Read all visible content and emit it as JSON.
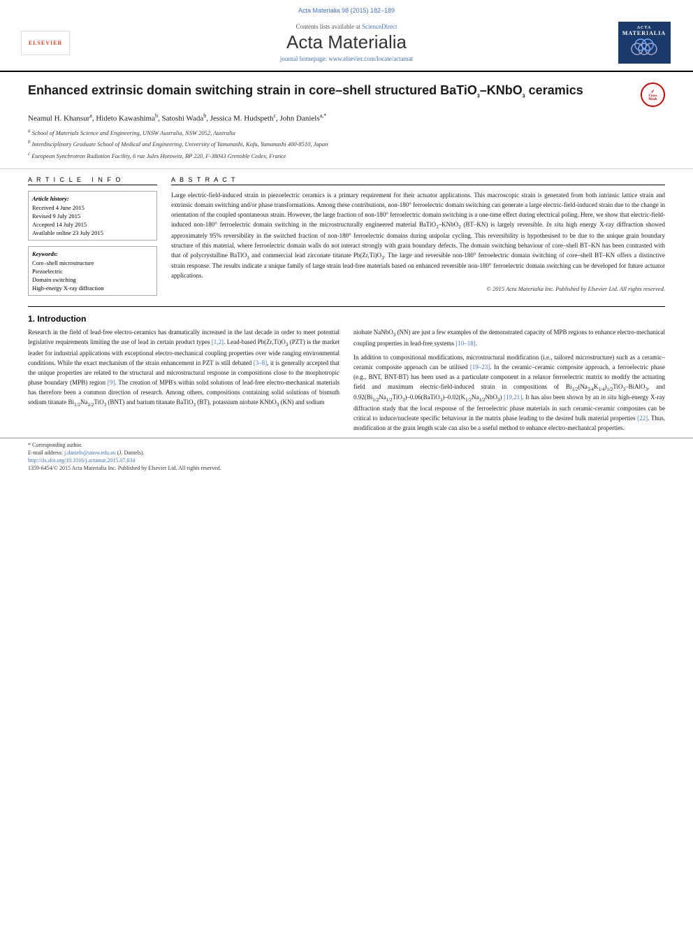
{
  "header": {
    "journal_ref": "Acta Materialia 98 (2015) 182–189",
    "contents_line": "Contents lists available at",
    "sciencedirect": "ScienceDirect",
    "journal_name": "Acta Materialia",
    "homepage_label": "journal homepage: www.elsevier.com/locate/actamat"
  },
  "article": {
    "title": "Enhanced extrinsic domain switching strain in core–shell structured BaTiO₃–KNbO₃ ceramics",
    "authors": "Neamul H. Khansur a, Hideto Kawashima b, Satoshi Wada b, Jessica M. Hudspeth c, John Daniels a,*",
    "affiliations": [
      "a School of Materials Science and Engineering, UNSW Australia, NSW 2052, Australia",
      "b Interdisciplinary Graduate School of Medical and Engineering, University of Yamanashi, Kofu, Yamanashi 400-8510, Japan",
      "c European Synchrotron Radiation Facility, 6 rue Jules Horowitz, BP 220, F-38043 Grenoble Cedex, France"
    ]
  },
  "article_info": {
    "section_label": "Article Info",
    "history_label": "Article history:",
    "received": "Received 4 June 2015",
    "revised": "Revised 9 July 2015",
    "accepted": "Accepted 14 July 2015",
    "available": "Available online 23 July 2015",
    "keywords_label": "Keywords:",
    "keyword1": "Core–shell microstructure",
    "keyword2": "Piezoelectric",
    "keyword3": "Domain switching",
    "keyword4": "High-energy X-ray diffraction"
  },
  "abstract": {
    "section_label": "Abstract",
    "text": "Large electric-field-induced strain in piezoelectric ceramics is a primary requirement for their actuator applications. This macroscopic strain is generated from both intrinsic lattice strain and extrinsic domain switching and/or phase transformations. Among these contributions, non-180° ferroelectric domain switching can generate a large electric-field-induced strain due to the change in orientation of the coupled spontaneous strain. However, the large fraction of non-180° ferroelectric domain switching is a one-time effect during electrical poling. Here, we show that electric-field-induced non-180° ferroelectric domain switching in the microstructurally engineered material BaTiO₃–KNbO₃ (BT–KN) is largely reversible. In situ high energy X-ray diffraction showed approximately 95% reversibility in the switched fraction of non-180° ferroelectric domains during unipolar cycling. This reversibility is hypothesised to be due to the unique grain boundary structure of this material, where ferroelectric domain walls do not interact strongly with grain boundary defects. The domain switching behaviour of core–shell BT–KN has been contrasted with that of polycrystalline BaTiO₃ and commercial lead zirconate titanate Pb(Zr,Ti)O₃. The large and reversible non-180° ferroelectric domain switching of core–shell BT–KN offers a distinctive strain response. The results indicate a unique family of large strain lead-free materials based on enhanced reversible non-180° ferroelectric domain switching can be developed for future actuator applications.",
    "copyright": "© 2015 Acta Materialia Inc. Published by Elsevier Ltd. All rights reserved."
  },
  "intro": {
    "heading": "1. Introduction",
    "col1_p1": "Research in the field of lead-free electro-ceramics has dramatically increased in the last decade in order to meet potential legislative requirements limiting the use of lead in certain product types [1,2]. Lead-based Pb(Zr,Ti)O₃ (PZT) is the market leader for industrial applications with exceptional electro-mechanical coupling properties over wide ranging environmental conditions. While the exact mechanism of the strain enhancement in PZT is still debated [3–8], it is generally accepted that the unique properties are related to the structural and microstructural response in compositions close to the morphotropic phase boundary (MPB) region [9]. The creation of MPB's within solid solutions of lead-free electro-mechanical materials has therefore been a common direction of research. Among others, compositions containing solid solutions of bismuth sodium titanate Bi₁/₂Na₁/₂TiO₃ (BNT) and barium titanate BaTiO₃ (BT), potassium niobate KNbO₃ (KN) and sodium",
    "col2_p1": "niobate NaNbO₃ (NN) are just a few examples of the demonstrated capacity of MPB regions to enhance electro-mechanical coupling properties in lead-free systems [10–18].",
    "col2_p2": "In addition to compositional modifications, microstructural modification (i.e., tailored microstructure) such as a ceramic–ceramic composite approach can be utilised [19–23]. In the ceramic–ceramic composite approach, a ferroelectric phase (e.g., BNT, BNT-BT) has been used as a particulate component in a relaxor ferroelectric matrix to modify the actuating field and maximum electric-field-induced strain in compositions of Bi₁/₂(Na₃/₄K₁/₄)₁/₂TiO₃–BiAlO₃, and 0.92(Bi₁/₂Na₁/₂TiO₃)–0.06(BaTiO₃)–0.02(K₁/₂Na₁/₂NbO₃) [19,21]. It has also been shown by an in situ high-energy X-ray diffraction study that the local response of the ferroelectric phase materials in such ceramic-ceramic composites can be critical to induce/nucleate specific behaviour in the matrix phase leading to the desired bulk material properties [22]. Thus, modification at the grain length scale can also be a useful method to enhance electro-mechanical properties."
  },
  "footer": {
    "corresponding_author": "* Corresponding author.",
    "email_label": "E-mail address:",
    "email": "j.daniels@unsw.edu.au",
    "email_suffix": "(J. Daniels).",
    "doi": "http://dx.doi.org/10.1016/j.actamat.2015.07.034",
    "issn": "1359-6454/© 2015 Acta Materialia Inc. Published by Elsevier Ltd. All rights reserved."
  }
}
